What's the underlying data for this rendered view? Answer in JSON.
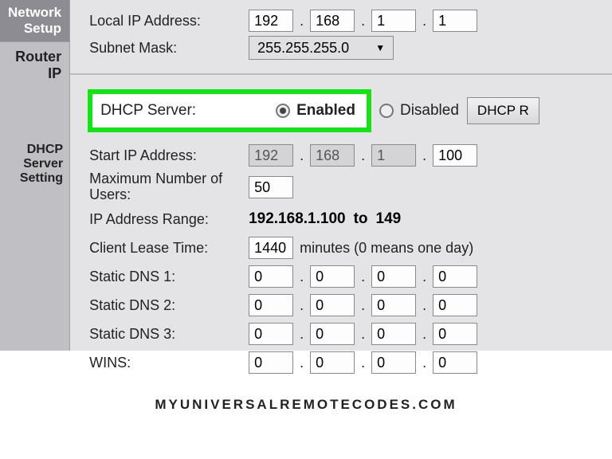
{
  "sidebar": {
    "section_title": "Network Setup",
    "router_ip": "Router IP",
    "dhcp_section": "DHCP Server Setting"
  },
  "router_ip": {
    "local_ip_label": "Local IP Address:",
    "local_ip": [
      "192",
      "168",
      "1",
      "1"
    ],
    "subnet_label": "Subnet Mask:",
    "subnet_value": "255.255.255.0"
  },
  "dhcp": {
    "server_label": "DHCP Server:",
    "enabled_label": "Enabled",
    "disabled_label": "Disabled",
    "reservation_button": "DHCP R",
    "start_ip_label": "Start IP Address:",
    "start_ip": [
      "192",
      "168",
      "1",
      "100"
    ],
    "max_users_label": "Maximum Number of Users:",
    "max_users_value": "50",
    "range_label": "IP Address Range:",
    "range_value": "192.168.1.100",
    "range_to": "to",
    "range_end": "149",
    "lease_label": "Client Lease Time:",
    "lease_value": "1440",
    "lease_note": "minutes (0 means one day)",
    "dns1_label": "Static DNS 1:",
    "dns1": [
      "0",
      "0",
      "0",
      "0"
    ],
    "dns2_label": "Static DNS 2:",
    "dns2": [
      "0",
      "0",
      "0",
      "0"
    ],
    "dns3_label": "Static DNS 3:",
    "dns3": [
      "0",
      "0",
      "0",
      "0"
    ],
    "wins_label": "WINS:",
    "wins": [
      "0",
      "0",
      "0",
      "0"
    ]
  },
  "footer": {
    "watermark": "MYUNIVERSALREMOTECODES.COM"
  }
}
